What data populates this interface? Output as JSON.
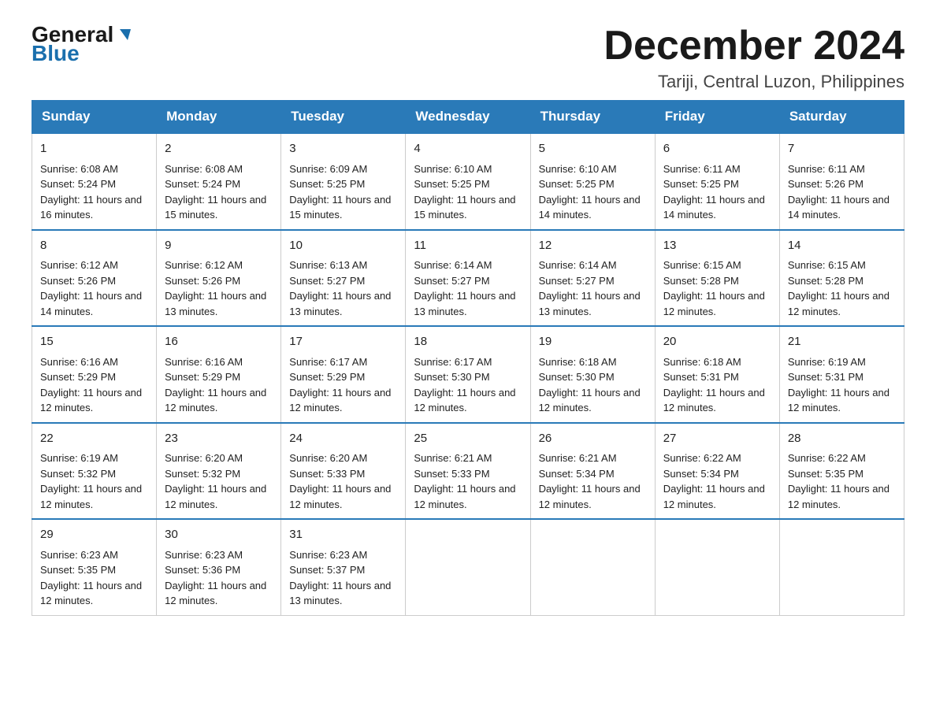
{
  "logo": {
    "general": "General",
    "blue": "Blue"
  },
  "header": {
    "month": "December 2024",
    "location": "Tariji, Central Luzon, Philippines"
  },
  "weekdays": [
    "Sunday",
    "Monday",
    "Tuesday",
    "Wednesday",
    "Thursday",
    "Friday",
    "Saturday"
  ],
  "weeks": [
    [
      {
        "day": "1",
        "sunrise": "6:08 AM",
        "sunset": "5:24 PM",
        "daylight": "11 hours and 16 minutes."
      },
      {
        "day": "2",
        "sunrise": "6:08 AM",
        "sunset": "5:24 PM",
        "daylight": "11 hours and 15 minutes."
      },
      {
        "day": "3",
        "sunrise": "6:09 AM",
        "sunset": "5:25 PM",
        "daylight": "11 hours and 15 minutes."
      },
      {
        "day": "4",
        "sunrise": "6:10 AM",
        "sunset": "5:25 PM",
        "daylight": "11 hours and 15 minutes."
      },
      {
        "day": "5",
        "sunrise": "6:10 AM",
        "sunset": "5:25 PM",
        "daylight": "11 hours and 14 minutes."
      },
      {
        "day": "6",
        "sunrise": "6:11 AM",
        "sunset": "5:25 PM",
        "daylight": "11 hours and 14 minutes."
      },
      {
        "day": "7",
        "sunrise": "6:11 AM",
        "sunset": "5:26 PM",
        "daylight": "11 hours and 14 minutes."
      }
    ],
    [
      {
        "day": "8",
        "sunrise": "6:12 AM",
        "sunset": "5:26 PM",
        "daylight": "11 hours and 14 minutes."
      },
      {
        "day": "9",
        "sunrise": "6:12 AM",
        "sunset": "5:26 PM",
        "daylight": "11 hours and 13 minutes."
      },
      {
        "day": "10",
        "sunrise": "6:13 AM",
        "sunset": "5:27 PM",
        "daylight": "11 hours and 13 minutes."
      },
      {
        "day": "11",
        "sunrise": "6:14 AM",
        "sunset": "5:27 PM",
        "daylight": "11 hours and 13 minutes."
      },
      {
        "day": "12",
        "sunrise": "6:14 AM",
        "sunset": "5:27 PM",
        "daylight": "11 hours and 13 minutes."
      },
      {
        "day": "13",
        "sunrise": "6:15 AM",
        "sunset": "5:28 PM",
        "daylight": "11 hours and 12 minutes."
      },
      {
        "day": "14",
        "sunrise": "6:15 AM",
        "sunset": "5:28 PM",
        "daylight": "11 hours and 12 minutes."
      }
    ],
    [
      {
        "day": "15",
        "sunrise": "6:16 AM",
        "sunset": "5:29 PM",
        "daylight": "11 hours and 12 minutes."
      },
      {
        "day": "16",
        "sunrise": "6:16 AM",
        "sunset": "5:29 PM",
        "daylight": "11 hours and 12 minutes."
      },
      {
        "day": "17",
        "sunrise": "6:17 AM",
        "sunset": "5:29 PM",
        "daylight": "11 hours and 12 minutes."
      },
      {
        "day": "18",
        "sunrise": "6:17 AM",
        "sunset": "5:30 PM",
        "daylight": "11 hours and 12 minutes."
      },
      {
        "day": "19",
        "sunrise": "6:18 AM",
        "sunset": "5:30 PM",
        "daylight": "11 hours and 12 minutes."
      },
      {
        "day": "20",
        "sunrise": "6:18 AM",
        "sunset": "5:31 PM",
        "daylight": "11 hours and 12 minutes."
      },
      {
        "day": "21",
        "sunrise": "6:19 AM",
        "sunset": "5:31 PM",
        "daylight": "11 hours and 12 minutes."
      }
    ],
    [
      {
        "day": "22",
        "sunrise": "6:19 AM",
        "sunset": "5:32 PM",
        "daylight": "11 hours and 12 minutes."
      },
      {
        "day": "23",
        "sunrise": "6:20 AM",
        "sunset": "5:32 PM",
        "daylight": "11 hours and 12 minutes."
      },
      {
        "day": "24",
        "sunrise": "6:20 AM",
        "sunset": "5:33 PM",
        "daylight": "11 hours and 12 minutes."
      },
      {
        "day": "25",
        "sunrise": "6:21 AM",
        "sunset": "5:33 PM",
        "daylight": "11 hours and 12 minutes."
      },
      {
        "day": "26",
        "sunrise": "6:21 AM",
        "sunset": "5:34 PM",
        "daylight": "11 hours and 12 minutes."
      },
      {
        "day": "27",
        "sunrise": "6:22 AM",
        "sunset": "5:34 PM",
        "daylight": "11 hours and 12 minutes."
      },
      {
        "day": "28",
        "sunrise": "6:22 AM",
        "sunset": "5:35 PM",
        "daylight": "11 hours and 12 minutes."
      }
    ],
    [
      {
        "day": "29",
        "sunrise": "6:23 AM",
        "sunset": "5:35 PM",
        "daylight": "11 hours and 12 minutes."
      },
      {
        "day": "30",
        "sunrise": "6:23 AM",
        "sunset": "5:36 PM",
        "daylight": "11 hours and 12 minutes."
      },
      {
        "day": "31",
        "sunrise": "6:23 AM",
        "sunset": "5:37 PM",
        "daylight": "11 hours and 13 minutes."
      },
      null,
      null,
      null,
      null
    ]
  ]
}
